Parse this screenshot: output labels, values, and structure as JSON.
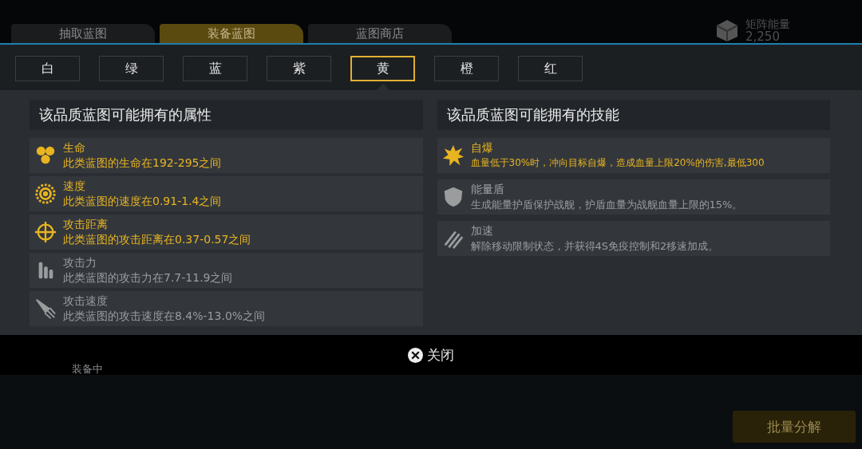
{
  "background_tabs": [
    {
      "label": "抽取蓝图",
      "selected": false
    },
    {
      "label": "装备蓝图",
      "selected": true
    },
    {
      "label": "蓝图商店",
      "selected": false
    }
  ],
  "matrix_energy": {
    "label": "矩阵能量",
    "value": "2,250"
  },
  "quality_tabs": [
    {
      "label": "白",
      "selected": false
    },
    {
      "label": "绿",
      "selected": false
    },
    {
      "label": "蓝",
      "selected": false
    },
    {
      "label": "紫",
      "selected": false
    },
    {
      "label": "黄",
      "selected": true
    },
    {
      "label": "橙",
      "selected": false
    },
    {
      "label": "红",
      "selected": false
    }
  ],
  "attributes": {
    "title": "该品质蓝图可能拥有的属性",
    "items": [
      {
        "kind": "hexagons",
        "name": "生命",
        "desc": "此类蓝图的生命在192-295之间",
        "active": true
      },
      {
        "kind": "gear",
        "name": "速度",
        "desc": "此类蓝图的速度在0.91-1.4之间",
        "active": true
      },
      {
        "kind": "crosshair",
        "name": "攻击距离",
        "desc": "此类蓝图的攻击距离在0.37-0.57之间",
        "active": true
      },
      {
        "kind": "bullets",
        "name": "攻击力",
        "desc": "此类蓝图的攻击力在7.7-11.9之间",
        "active": false
      },
      {
        "kind": "rocket",
        "name": "攻击速度",
        "desc": "此类蓝图的攻击速度在8.4%-13.0%之间",
        "active": false
      }
    ]
  },
  "skills": {
    "title": "该品质蓝图可能拥有的技能",
    "items": [
      {
        "kind": "explosion",
        "name": "自爆",
        "desc": "血量低于30%时，冲向目标自爆，造成血量上限20%的伤害,最低300",
        "active": true
      },
      {
        "kind": "shield",
        "name": "能量盾",
        "desc": "生成能量护盾保护战舰，护盾血量为战舰血量上限的15%。",
        "active": false
      },
      {
        "kind": "streaks",
        "name": "加速",
        "desc": "解除移动限制状态，并获得4S免疫控制和2移速加成。",
        "active": false
      }
    ]
  },
  "close_button": "关闭",
  "background_status": "装备中",
  "batch_button": "批量分解"
}
